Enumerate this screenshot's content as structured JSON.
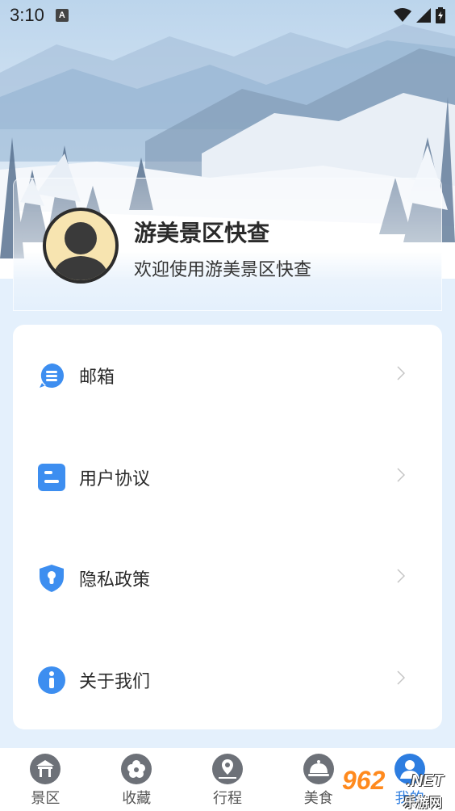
{
  "status_bar": {
    "time": "3:10",
    "notification_badge": "A"
  },
  "profile": {
    "title": "游美景区快查",
    "subtitle": "欢迎使用游美景区快查"
  },
  "menu": {
    "items": [
      {
        "label": "邮箱",
        "icon": "message-icon"
      },
      {
        "label": "用户协议",
        "icon": "agreement-icon"
      },
      {
        "label": "隐私政策",
        "icon": "shield-keyhole-icon"
      },
      {
        "label": "关于我们",
        "icon": "info-icon"
      }
    ]
  },
  "bottom_nav": {
    "items": [
      {
        "label": "景区",
        "icon": "scenic-gate-icon"
      },
      {
        "label": "收藏",
        "icon": "flower-icon"
      },
      {
        "label": "行程",
        "icon": "route-pin-icon"
      },
      {
        "label": "美食",
        "icon": "food-cloche-icon"
      },
      {
        "label": "我的",
        "icon": "user-icon"
      }
    ],
    "active_index": 4
  },
  "watermark": {
    "brand": "962",
    "suffix": ".NET",
    "sub": "乐游网"
  },
  "colors": {
    "accent": "#2d7de0",
    "icon_blue": "#3d8ef0",
    "page_bg": "#e4f0fc"
  }
}
